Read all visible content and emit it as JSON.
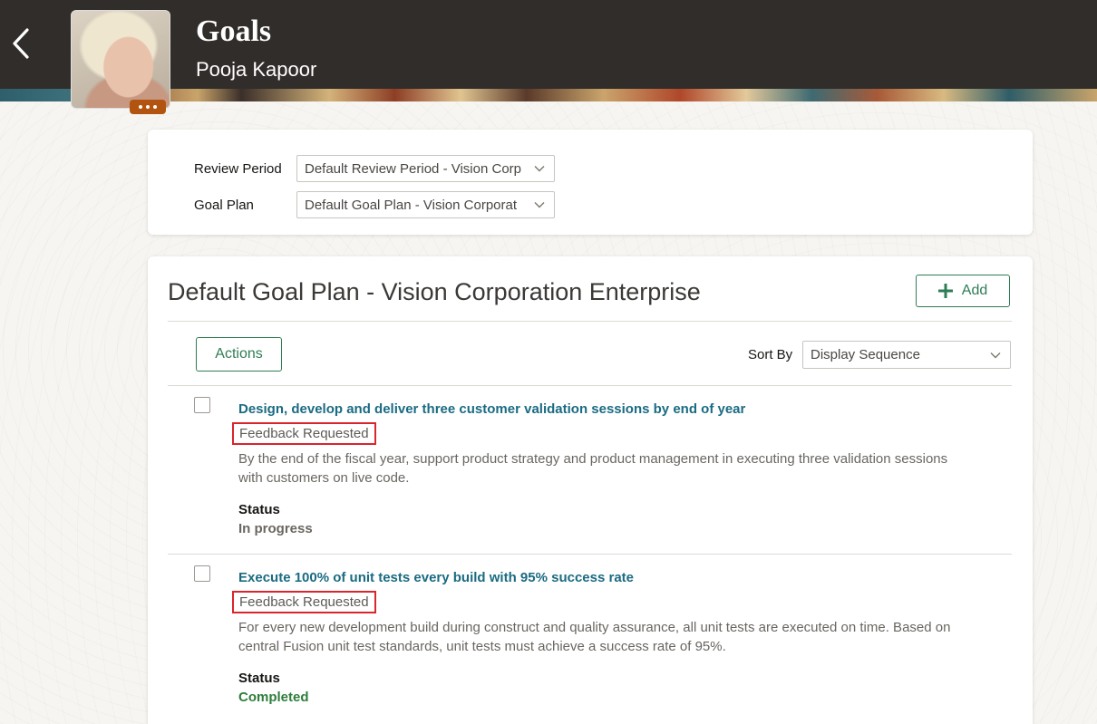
{
  "header": {
    "title": "Goals",
    "person_name": "Pooja Kapoor"
  },
  "filters": {
    "review_period": {
      "label": "Review Period",
      "value": "Default Review Period - Vision Corp"
    },
    "goal_plan": {
      "label": "Goal Plan",
      "value": "Default Goal Plan - Vision Corporat"
    }
  },
  "main": {
    "plan_title": "Default Goal Plan - Vision Corporation Enterprise",
    "add_label": "Add",
    "actions_label": "Actions",
    "sort_label": "Sort By",
    "sort_value": "Display Sequence"
  },
  "goals": [
    {
      "title": "Design, develop and deliver three customer validation sessions by end of year",
      "badge": "Feedback Requested",
      "description": "By the end of the fiscal year, support product strategy and product management in executing three validation sessions with customers on live code.",
      "status_label": "Status",
      "status": "In progress",
      "status_color": "#6a6661"
    },
    {
      "title": "Execute 100% of unit tests every build with 95% success rate",
      "badge": "Feedback Requested",
      "description": "For every new development build during construct and quality assurance, all unit tests are executed on time. Based on central Fusion unit test standards, unit tests must achieve a success rate of 95%.",
      "status_label": "Status",
      "status": "Completed",
      "status_color": "#2e7d3a"
    }
  ],
  "colors": {
    "header_bg": "#312d2a",
    "accent_green": "#2f7d55",
    "link_teal": "#1a6b82",
    "highlight_red": "#d9252c",
    "avatar_menu": "#b2540f"
  },
  "icons": [
    "back-chevron-icon",
    "more-dots-icon",
    "chevron-down-icon",
    "plus-icon"
  ]
}
